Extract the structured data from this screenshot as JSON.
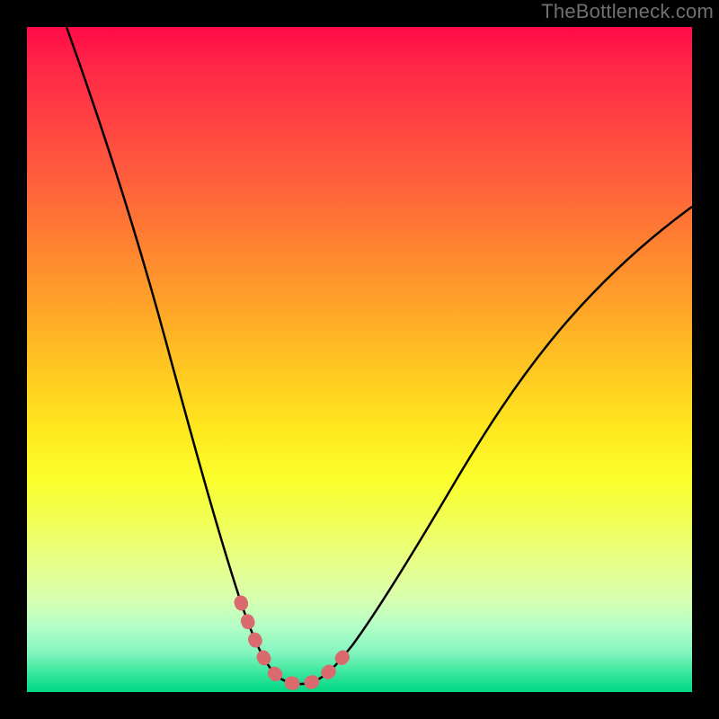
{
  "watermark": "TheBottleneck.com",
  "chart_data": {
    "type": "line",
    "title": "",
    "xlabel": "",
    "ylabel": "",
    "xlim": [
      0,
      100
    ],
    "ylim": [
      0,
      100
    ],
    "series": [
      {
        "name": "bottleneck-curve",
        "x": [
          6,
          10,
          14,
          18,
          22,
          26,
          28,
          30,
          32,
          34,
          36,
          38,
          40,
          42,
          44,
          46,
          50,
          55,
          60,
          65,
          70,
          75,
          80,
          85,
          90,
          95,
          100
        ],
        "y": [
          100,
          90,
          80,
          70,
          60,
          44,
          36,
          28,
          20,
          12,
          6,
          3,
          1.5,
          1,
          1.5,
          3,
          6,
          12,
          19,
          26,
          33,
          40,
          47,
          54,
          60,
          66,
          72
        ]
      },
      {
        "name": "highlight-segment",
        "x": [
          32,
          34,
          36,
          38,
          40,
          42,
          44,
          46,
          48
        ],
        "y": [
          20,
          12,
          6,
          3,
          1.5,
          1,
          1.5,
          3,
          5
        ]
      }
    ],
    "colors": {
      "curve": "#000000",
      "highlight": "#d96b6f"
    }
  }
}
